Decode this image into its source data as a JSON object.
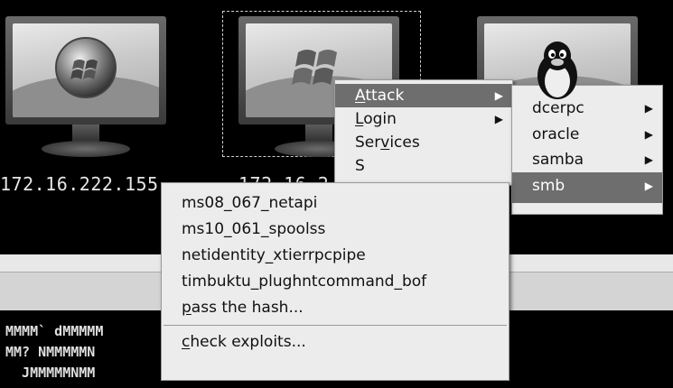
{
  "hosts": [
    {
      "ip": "172.16.222.155",
      "os_icon": "windows-vista-orb-icon"
    },
    {
      "ip": "172.16.2",
      "os_icon": "windows-xp-logo-icon",
      "selected": true
    },
    {
      "ip": "",
      "os_icon": "linux-tux-icon"
    }
  ],
  "context_menu": {
    "items": [
      {
        "label": "Attack",
        "has_submenu": true
      },
      {
        "label": "Login",
        "has_submenu": true
      },
      {
        "label": "Services",
        "has_submenu": false
      },
      {
        "label": "S",
        "has_submenu": false
      }
    ]
  },
  "attack_submenu": {
    "items": [
      {
        "label": "dcerpc"
      },
      {
        "label": "oracle"
      },
      {
        "label": "samba"
      },
      {
        "label": "smb"
      }
    ]
  },
  "smb_submenu": {
    "items": [
      {
        "label": "ms08_067_netapi"
      },
      {
        "label": "ms10_061_spoolss"
      },
      {
        "label": "netidentity_xtierrpcpipe"
      },
      {
        "label": "timbuktu_plughntcommand_bof"
      },
      {
        "label": "pass the hash..."
      },
      {
        "label": "check exploits..."
      }
    ]
  },
  "console": {
    "lines": [
      "\"\"\"\"\"\"\"\" \"\"\"\"\"\"\"",
      "MMMM` dMMMMM",
      "MM? NMMMMMN",
      "  JMMMMMNMM"
    ]
  },
  "colors": {
    "menu_bg": "#ececec",
    "selected_bg": "#6e6e6e",
    "canvas_bg": "#000000"
  }
}
